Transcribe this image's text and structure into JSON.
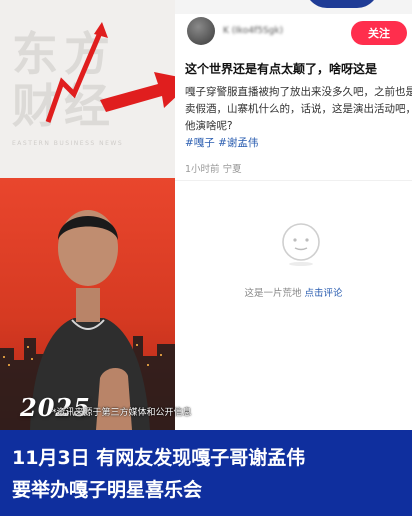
{
  "brand": {
    "logo_line1": "东方",
    "logo_line2": "财经",
    "logo_sub": "EASTERN BUSINESS NEWS"
  },
  "poster": {
    "year": "2025"
  },
  "post": {
    "username": "K (Iko4f5Sgk)",
    "follow_label": "关注",
    "title": "这个世界还是有点太颠了，啥呀这是",
    "body": "嘎子穿警服直播被拘了放出来没多久吧，之前也是卖假酒，山寨机什么的，话说，这是演出活动吧，他演啥呢?",
    "tags": "#嘎子 #谢孟伟",
    "meta": "1小时前 宁夏"
  },
  "comments": {
    "empty_text": "这是一片荒地",
    "comment_link": "点击评论"
  },
  "disclaimer": "*资讯来源于第三方媒体和公开信息",
  "caption": {
    "line1": "11月3日 有网友发现嘎子哥谢孟伟",
    "line2": "要举办嘎子明星喜乐会"
  },
  "colors": {
    "accent_red": "#ff2e4d",
    "caption_blue": "#0f2f9e",
    "link_blue": "#2a5db0"
  }
}
